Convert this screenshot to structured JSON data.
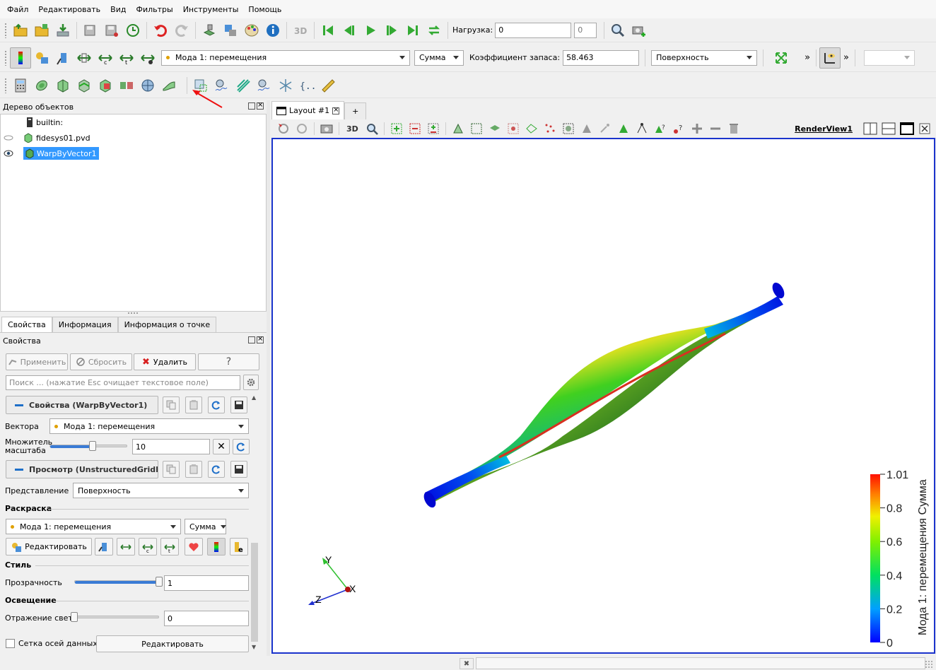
{
  "menu": [
    "Файл",
    "Редактировать",
    "Вид",
    "Фильтры",
    "Инструменты",
    "Помощь"
  ],
  "toolbar1": {
    "load_label": "Нагрузка:",
    "load_value": "0",
    "load_spin": "0"
  },
  "toolbar2": {
    "vector_combo": "Мода 1: перемещения",
    "component_combo": "Сумма",
    "safety_label": "Коэффициент запаса:",
    "safety_value": "58.463",
    "representation_combo": "Поверхность",
    "more1": "»",
    "more2": "»"
  },
  "pipeline": {
    "title": "Дерево объектов",
    "items": [
      {
        "label": "builtin:",
        "visible": null
      },
      {
        "label": "fidesys01.pvd",
        "visible": false
      },
      {
        "label": "WarpByVector1",
        "visible": true,
        "selected": true
      }
    ]
  },
  "tabs": [
    "Свойства",
    "Информация",
    "Информация о точке"
  ],
  "properties": {
    "title": "Свойства",
    "apply": "Применить",
    "reset": "Сбросить",
    "delete": "Удалить",
    "help": "?",
    "search_placeholder": "Поиск ... (нажатие Esc очищает текстовое поле)",
    "filter_section": "Свойства (WarpByVector1)",
    "vectors_label": "Вектора",
    "vectors_value": "Мода 1: перемещения",
    "scale_label": "Множитель масштаба",
    "scale_value": "10",
    "scale_fraction": 0.55,
    "view_section": "Просмотр (UnstructuredGridRe",
    "representation_label": "Представление",
    "representation_value": "Поверхность",
    "coloring_section": "Раскраска",
    "coloring_value": "Мода 1: перемещения",
    "coloring_component": "Сумма",
    "edit_label": "Редактировать",
    "style_section": "Стиль",
    "opacity_label": "Прозрачность",
    "opacity_value": "1",
    "opacity_fraction": 1.0,
    "lighting_section": "Освещение",
    "specular_label": "Отражение света",
    "specular_value": "0",
    "specular_fraction": 0.0,
    "axes_grid_label": "Сетка осей данных",
    "axes_grid_edit": "Редактировать"
  },
  "layout": {
    "tab_label": "Layout #1",
    "add_tab": "+",
    "view_name": "RenderView1",
    "view_toolbar_3d": "3D"
  },
  "render": {
    "colorbar_title": "Мода 1: перемещения Сумма",
    "colorbar_ticks": [
      "1.01",
      "0.8",
      "0.6",
      "0.4",
      "0.2",
      "0"
    ],
    "axes": {
      "x": "X",
      "y": "Y",
      "z": "Z"
    }
  },
  "colors": {
    "selection": "#3399ff",
    "view_border": "#1a33cc",
    "accent_red": "#d71f1f"
  }
}
